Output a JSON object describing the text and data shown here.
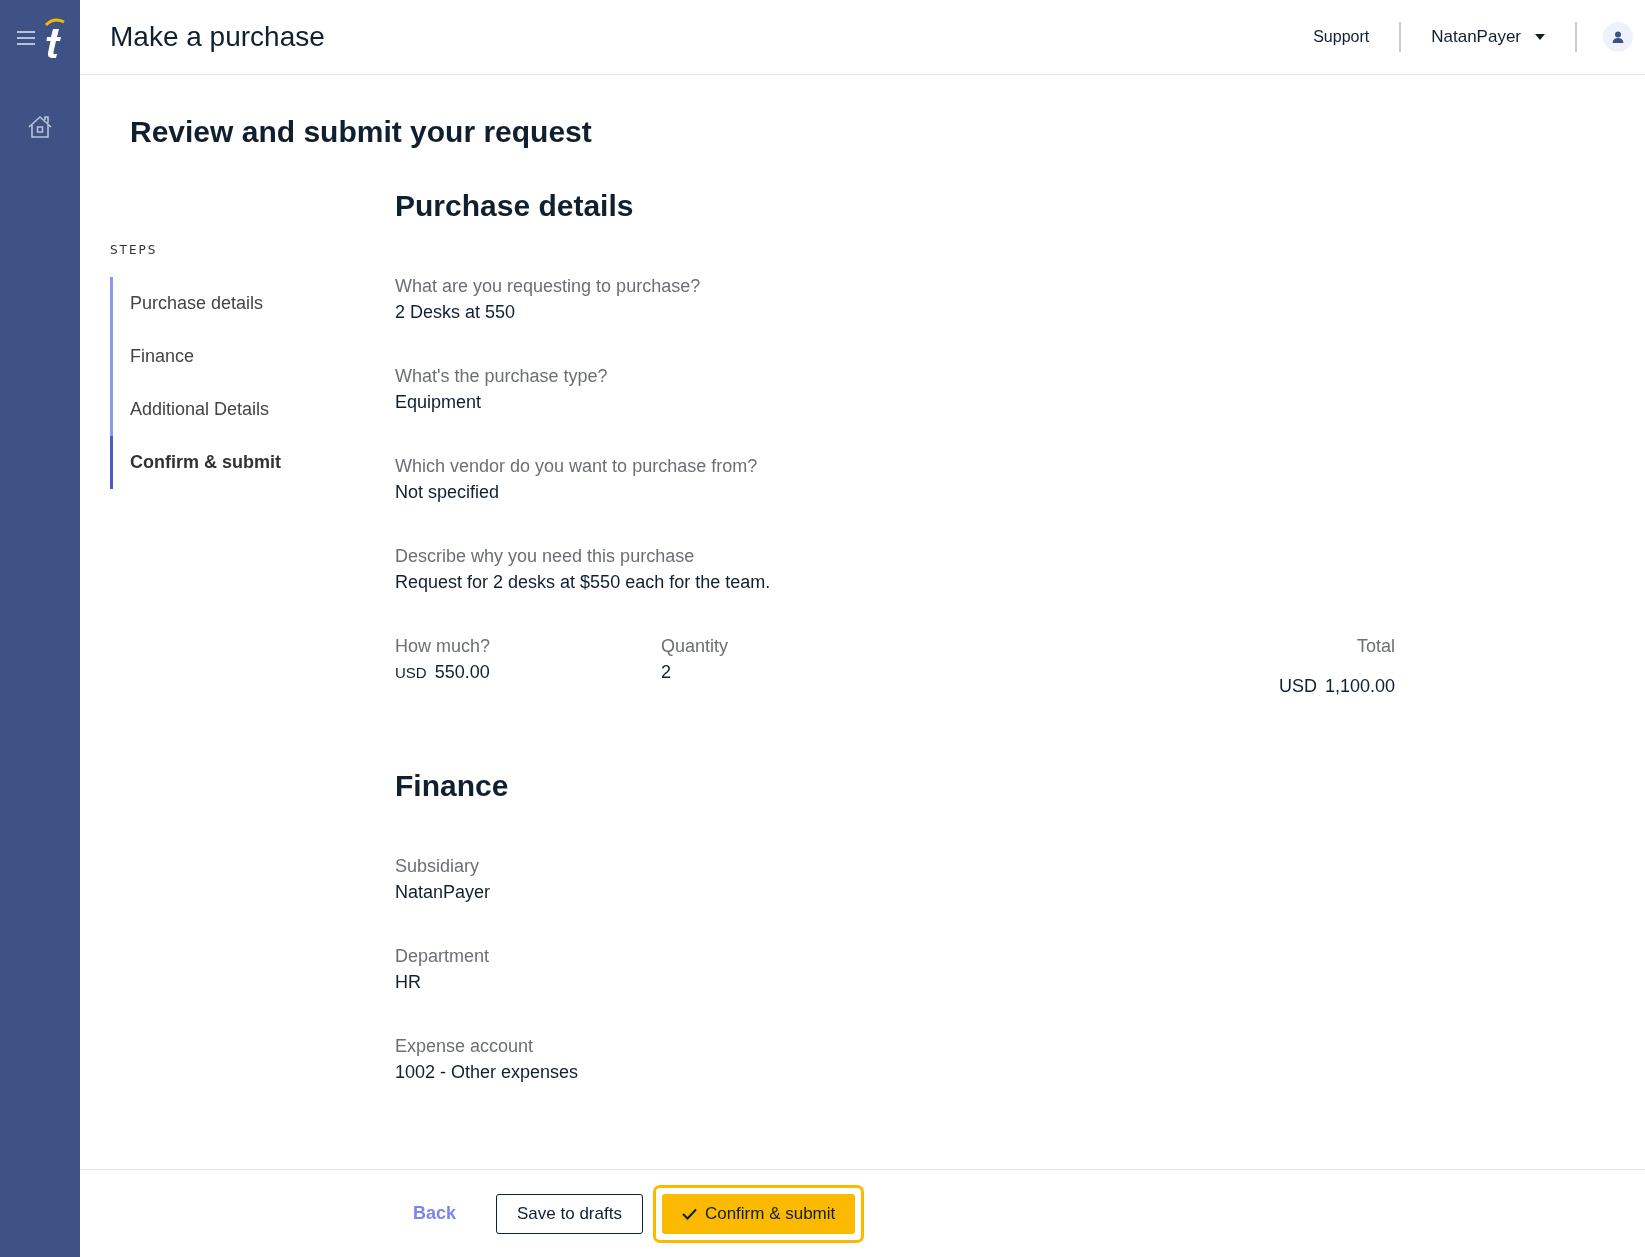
{
  "header": {
    "title": "Make a purchase",
    "support": "Support",
    "user": "NatanPayer"
  },
  "page_title": "Review and submit your request",
  "steps": {
    "label": "STEPS",
    "items": [
      {
        "label": "Purchase details",
        "selected": false
      },
      {
        "label": "Finance",
        "selected": false
      },
      {
        "label": "Additional Details",
        "selected": false
      },
      {
        "label": "Confirm & submit",
        "selected": true
      }
    ]
  },
  "sections": [
    {
      "title": "Purchase details",
      "fields": [
        {
          "label": "What are you requesting to purchase?",
          "value": "2 Desks at 550"
        },
        {
          "label": "What's the purchase type?",
          "value": "Equipment"
        },
        {
          "label": "Which vendor do you want to purchase from?",
          "value": "Not specified"
        },
        {
          "label": "Describe why you need this purchase",
          "value": "Request for 2 desks at $550 each for the team."
        }
      ],
      "amounts": {
        "price_label": "How much?",
        "price_currency": "USD",
        "price": "550.00",
        "quantity_label": "Quantity",
        "quantity": "2",
        "total_label": "Total",
        "total_currency": "USD",
        "total": "1,100.00"
      }
    },
    {
      "title": "Finance",
      "fields": [
        {
          "label": "Subsidiary",
          "value": "NatanPayer"
        },
        {
          "label": "Department",
          "value": "HR"
        },
        {
          "label": "Expense account",
          "value": "1002 - Other expenses"
        }
      ]
    }
  ],
  "footer": {
    "back": "Back",
    "save": "Save to drafts",
    "confirm": "Confirm & submit"
  }
}
